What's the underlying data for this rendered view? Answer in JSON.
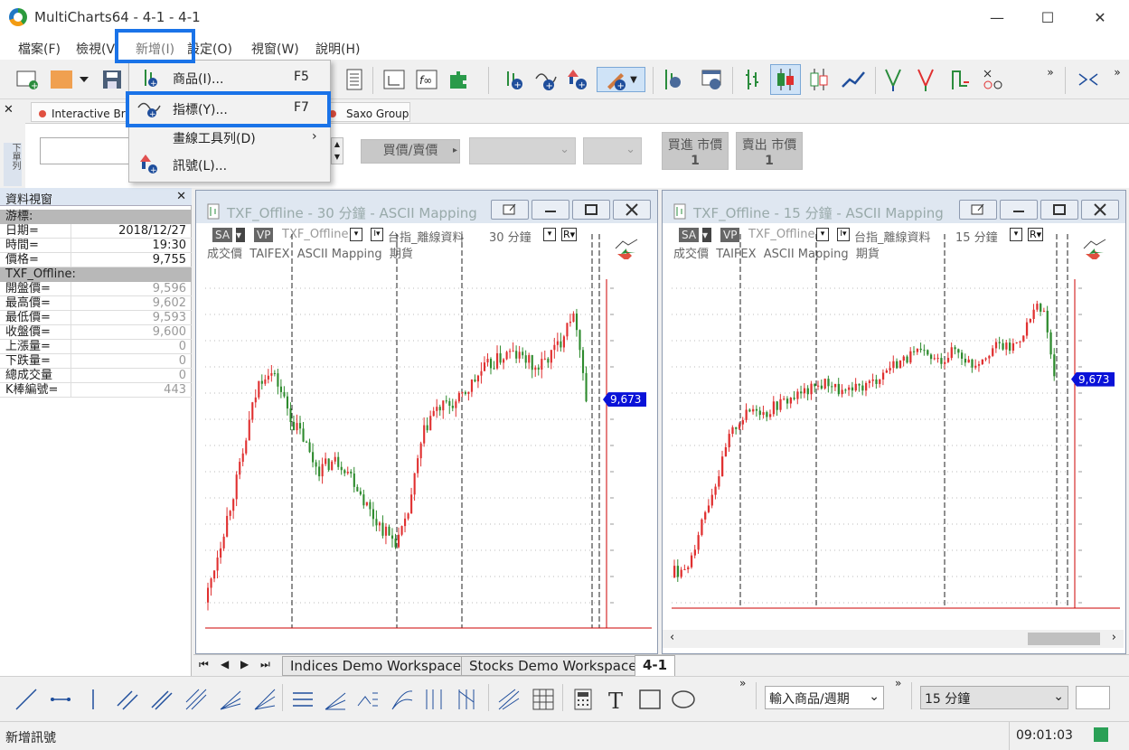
{
  "window": {
    "title": "MultiCharts64 - 4-1 - 4-1",
    "min": "—",
    "max": "☐",
    "close": "✕"
  },
  "menu": [
    "檔案(F)",
    "檢視(V)",
    "新增(I)",
    "設定(O)",
    "視窗(W)",
    "說明(H)"
  ],
  "dropdown": {
    "items": [
      {
        "label": "商品(I)...",
        "key": "F5"
      },
      {
        "label": "指標(Y)...",
        "key": "F7"
      },
      {
        "label": "畫線工具列(D)",
        "key": "›"
      },
      {
        "label": "訊號(L)...",
        "key": ""
      }
    ]
  },
  "tradebar": {
    "brokers": [
      "Interactive Br",
      "Saxo Group"
    ],
    "price_type": "買價/賣價",
    "buy_market": "買進 市價",
    "sell_market": "賣出 市價",
    "qty": "1",
    "side_label": "下單列"
  },
  "data_window": {
    "title": "資料視窗",
    "sections": [
      {
        "header": "游標:",
        "rows": [
          [
            "日期=",
            "2018/12/27"
          ],
          [
            "時間=",
            "19:30"
          ],
          [
            "價格=",
            "9,755"
          ]
        ]
      },
      {
        "header": "TXF_Offline:",
        "rows": [
          [
            "開盤價=",
            "9,596"
          ],
          [
            "最高價=",
            "9,602"
          ],
          [
            "最低價=",
            "9,593"
          ],
          [
            "收盤價=",
            "9,600"
          ],
          [
            "上漲量=",
            "0"
          ],
          [
            "下跌量=",
            "0"
          ],
          [
            "總成交量",
            "0"
          ],
          [
            "K棒編號=",
            "443"
          ]
        ]
      }
    ]
  },
  "charts": [
    {
      "title": "TXF_Offline - 30 分鐘 - ASCII Mapping",
      "sa": "SA",
      "vp": "VP",
      "symbol": "TXF_Offline",
      "name": "台指_離線資料",
      "interval": "30 分鐘",
      "line2": "成交價  TAIFEX  ASCII Mapping  期貨",
      "last": "9,673",
      "r": "R"
    },
    {
      "title": "TXF_Offline - 15 分鐘 - ASCII Mapping",
      "sa": "SA",
      "vp": "VP",
      "symbol": "TXF_Offline",
      "name": "台指_離線資料",
      "interval": "15 分鐘",
      "line2": "成交價  TAIFEX  ASCII Mapping  期貨",
      "last": "9,673",
      "r": "R"
    }
  ],
  "workspaces": [
    "Indices Demo Workspace",
    "Stocks Demo Workspace",
    "4-1"
  ],
  "drawbar": {
    "symbol_input": "輸入商品/週期",
    "interval_select": "15 分鐘"
  },
  "status": {
    "message": "新增訊號",
    "time": "09:01:03"
  },
  "colors": {
    "up": "#e03030",
    "down": "#2e8b2e",
    "price_tag": "#0a12d8",
    "highlight": "#1a73e8"
  }
}
